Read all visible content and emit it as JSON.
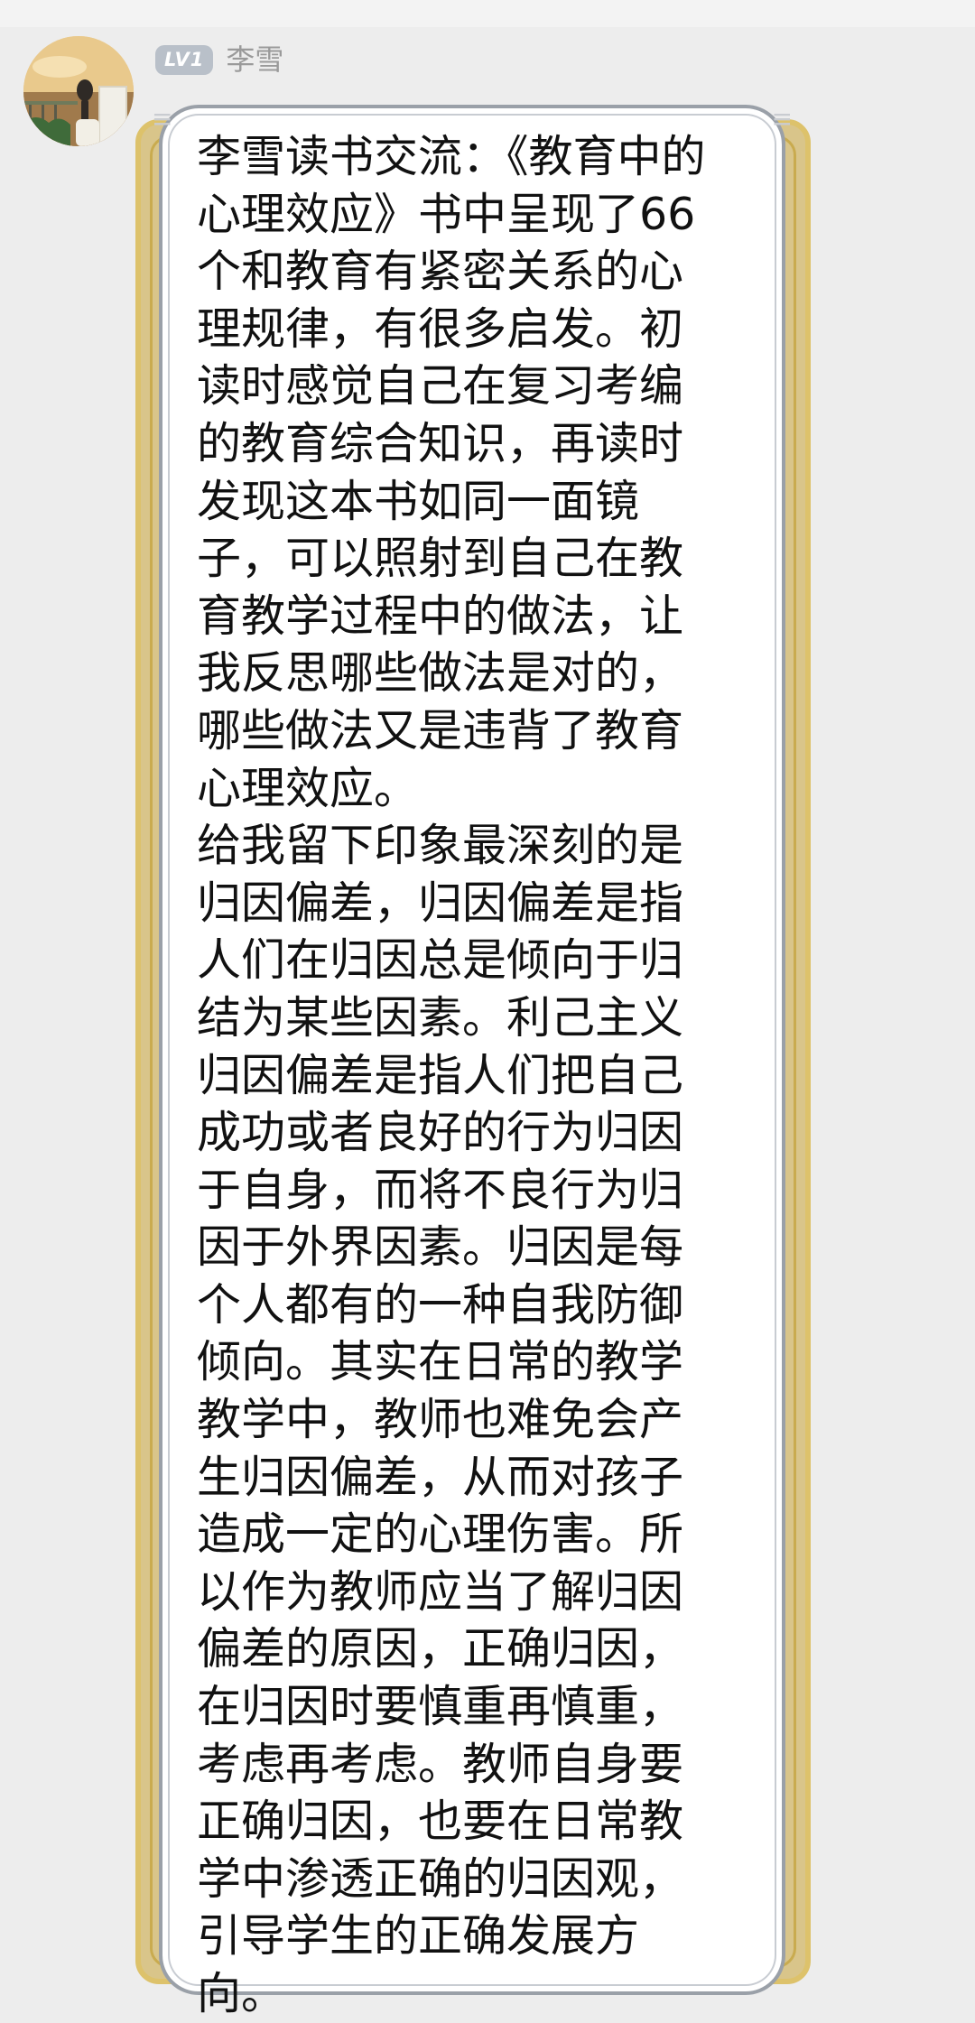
{
  "message": {
    "level_badge": "LV1",
    "sender_name": "李雪",
    "text": "李雪读书交流：《教育中的\n心理效应》书中呈现了66\n个和教育有紧密关系的心\n理规律，有很多启发。初\n读时感觉自己在复习考编\n的教育综合知识，再读时\n发现这本书如同一面镜\n子，可以照射到自己在教\n育教学过程中的做法，让\n我反思哪些做法是对的，\n哪些做法又是违背了教育\n心理效应。\n给我留下印象最深刻的是\n归因偏差，归因偏差是指\n人们在归因总是倾向于归\n结为某些因素。利己主义\n归因偏差是指人们把自己\n成功或者良好的行为归因\n于自身，而将不良行为归\n因于外界因素。归因是每\n个人都有的一种自我防御\n倾向。其实在日常的教学\n教学中，教师也难免会产\n生归因偏差，从而对孩子\n造成一定的心理伤害。所\n以作为教师应当了解归因\n偏差的原因，正确归因，\n在归因时要慎重再慎重，\n考虑再考虑。教师自身要\n正确归因，也要在日常教\n学中渗透正确的归因观，\n引导学生的正确发展方\n向。"
  },
  "colors": {
    "background": "#ededed",
    "bubble_fill": "#ffffff",
    "bubble_border": "#9aa0a8",
    "frame_gold": "#ddc26b",
    "badge_bg": "#b9c0c9",
    "name_color": "#9a9a9a",
    "text_color": "#111111"
  },
  "icons": {
    "avatar": "avatar-photo"
  }
}
